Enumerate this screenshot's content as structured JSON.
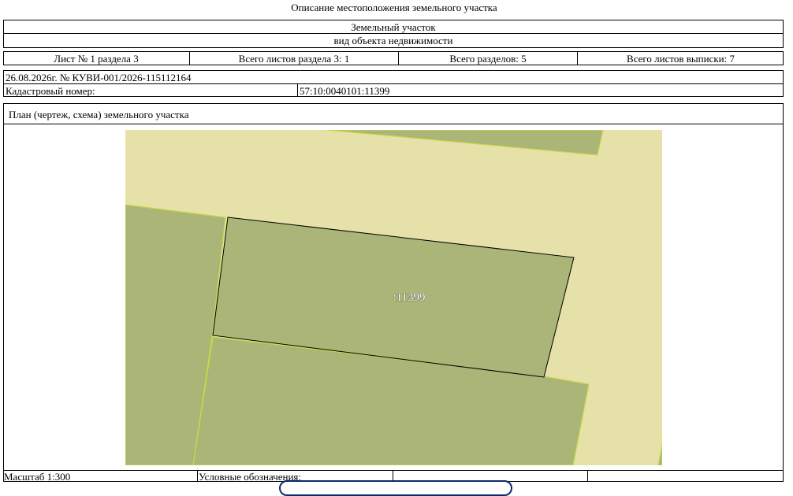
{
  "header": {
    "title": "Описание местоположения земельного участка",
    "object_name": "Земельный участок",
    "object_type_caption": "вид объекта недвижимости"
  },
  "sheet_info": {
    "sheet": "Лист № 1 раздела 3",
    "sheets_in_section": "Всего листов раздела 3: 1",
    "sections_total": "Всего разделов: 5",
    "sheets_total": "Всего листов выписки: 7"
  },
  "statement": {
    "date_number": "26.08.2026г. № КУВИ-001/2026-115112164",
    "cadastral_label": "Кадастровый номер:",
    "cadastral_value": "57:10:0040101:11399"
  },
  "plan": {
    "heading": "План (чертеж, схема) земельного участка",
    "parcel_label": ":11399",
    "colors": {
      "background": "#e5e1a8",
      "parcel_fill": "#abb577",
      "boundary": "#c8d84a",
      "outline": "#000000"
    }
  },
  "footer": {
    "scale": "Масштаб 1:300",
    "legend_label": "Условные обозначения:"
  }
}
